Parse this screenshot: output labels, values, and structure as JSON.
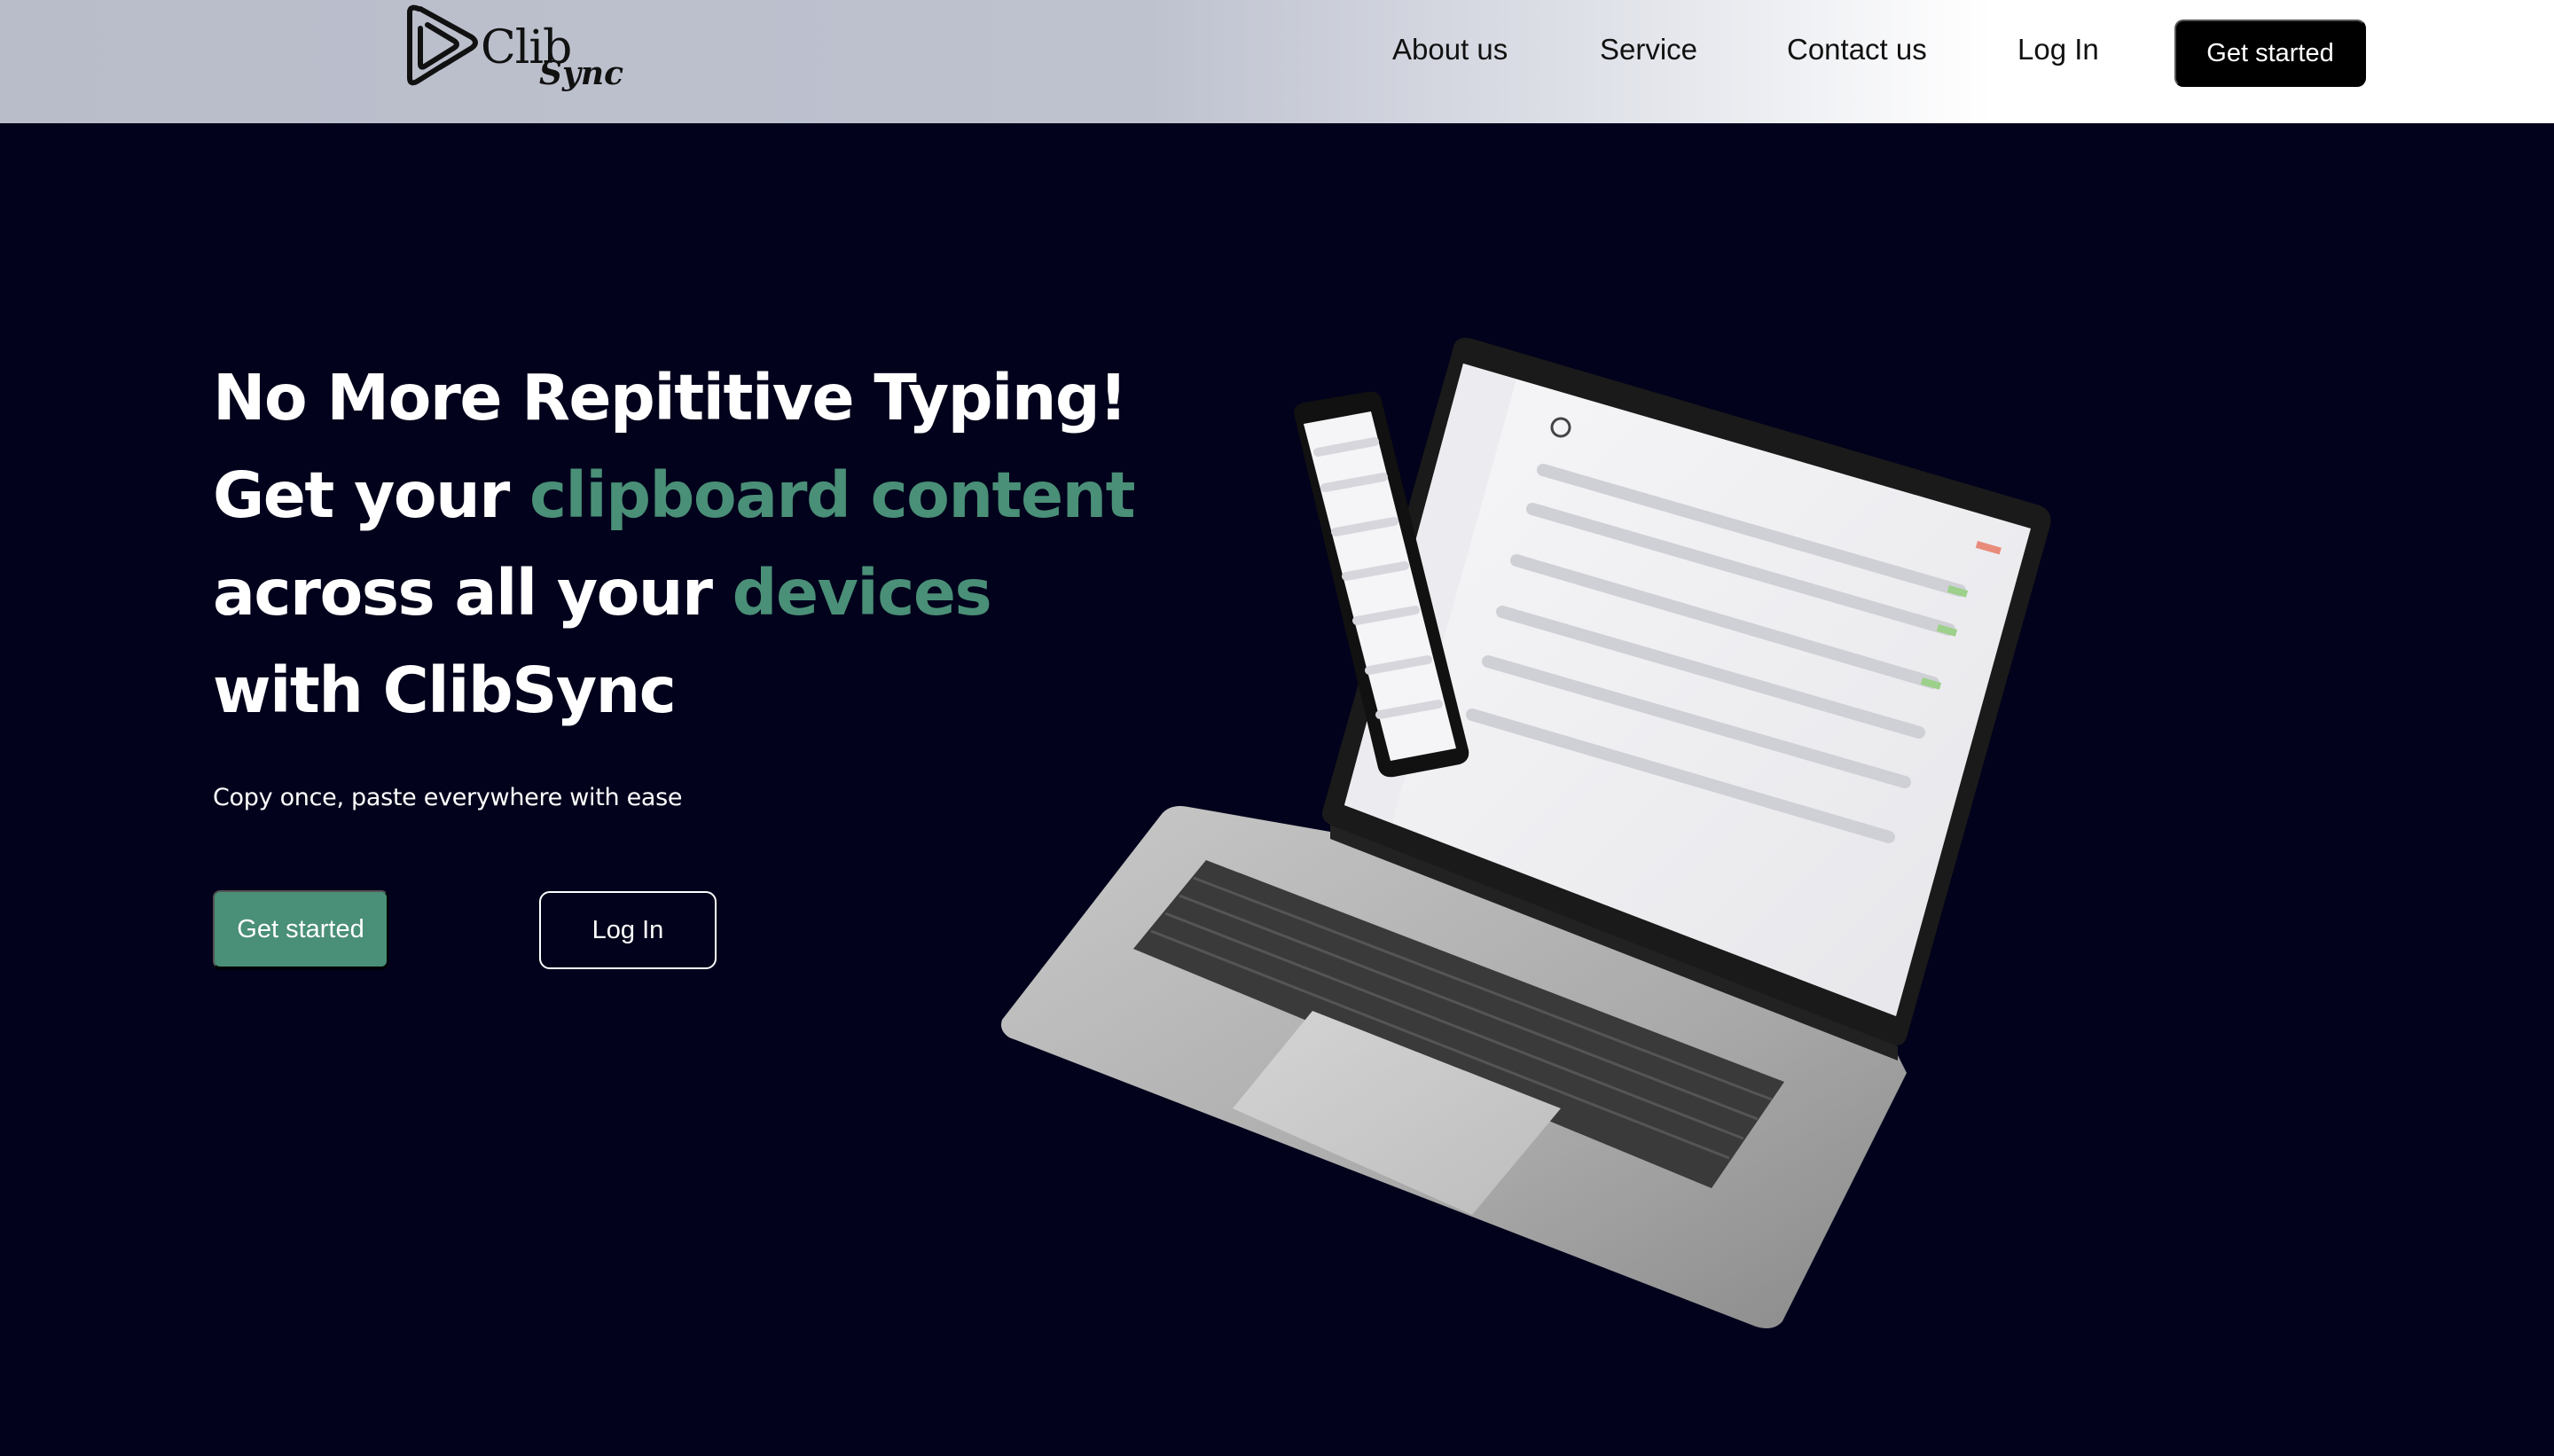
{
  "brand": {
    "logo_word": "Clib",
    "logo_script": "Sync",
    "logo_icon": "clibsync-logo-icon"
  },
  "nav": {
    "about": "About us",
    "service": "Service",
    "contact": "Contact us",
    "login": "Log In",
    "cta": "Get started"
  },
  "hero": {
    "line1": "No More Repititive Typing!",
    "line2_prefix": "Get your ",
    "line2_accent": "clipboard content",
    "line3_prefix": "across all your ",
    "line3_accent": "devices",
    "line4": "with ClibSync",
    "subtitle": "Copy once, paste everywhere with ease",
    "primary_button": "Get started",
    "secondary_button": "Log In"
  },
  "colors": {
    "background": "#02021c",
    "accent": "#4a8f77",
    "nav_button": "#000000"
  },
  "illustration": {
    "type": "laptop-and-phone-mockup"
  }
}
